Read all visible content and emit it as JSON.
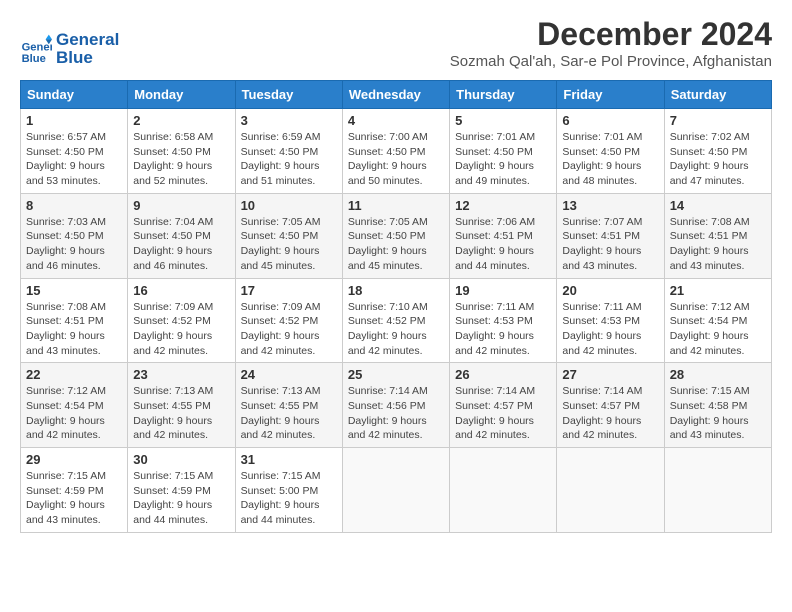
{
  "header": {
    "logo_line1": "General",
    "logo_line2": "Blue",
    "month_title": "December 2024",
    "location": "Sozmah Qal'ah, Sar-e Pol Province, Afghanistan"
  },
  "weekdays": [
    "Sunday",
    "Monday",
    "Tuesday",
    "Wednesday",
    "Thursday",
    "Friday",
    "Saturday"
  ],
  "weeks": [
    [
      {
        "day": "1",
        "sunrise": "Sunrise: 6:57 AM",
        "sunset": "Sunset: 4:50 PM",
        "daylight": "Daylight: 9 hours and 53 minutes."
      },
      {
        "day": "2",
        "sunrise": "Sunrise: 6:58 AM",
        "sunset": "Sunset: 4:50 PM",
        "daylight": "Daylight: 9 hours and 52 minutes."
      },
      {
        "day": "3",
        "sunrise": "Sunrise: 6:59 AM",
        "sunset": "Sunset: 4:50 PM",
        "daylight": "Daylight: 9 hours and 51 minutes."
      },
      {
        "day": "4",
        "sunrise": "Sunrise: 7:00 AM",
        "sunset": "Sunset: 4:50 PM",
        "daylight": "Daylight: 9 hours and 50 minutes."
      },
      {
        "day": "5",
        "sunrise": "Sunrise: 7:01 AM",
        "sunset": "Sunset: 4:50 PM",
        "daylight": "Daylight: 9 hours and 49 minutes."
      },
      {
        "day": "6",
        "sunrise": "Sunrise: 7:01 AM",
        "sunset": "Sunset: 4:50 PM",
        "daylight": "Daylight: 9 hours and 48 minutes."
      },
      {
        "day": "7",
        "sunrise": "Sunrise: 7:02 AM",
        "sunset": "Sunset: 4:50 PM",
        "daylight": "Daylight: 9 hours and 47 minutes."
      }
    ],
    [
      {
        "day": "8",
        "sunrise": "Sunrise: 7:03 AM",
        "sunset": "Sunset: 4:50 PM",
        "daylight": "Daylight: 9 hours and 46 minutes."
      },
      {
        "day": "9",
        "sunrise": "Sunrise: 7:04 AM",
        "sunset": "Sunset: 4:50 PM",
        "daylight": "Daylight: 9 hours and 46 minutes."
      },
      {
        "day": "10",
        "sunrise": "Sunrise: 7:05 AM",
        "sunset": "Sunset: 4:50 PM",
        "daylight": "Daylight: 9 hours and 45 minutes."
      },
      {
        "day": "11",
        "sunrise": "Sunrise: 7:05 AM",
        "sunset": "Sunset: 4:50 PM",
        "daylight": "Daylight: 9 hours and 45 minutes."
      },
      {
        "day": "12",
        "sunrise": "Sunrise: 7:06 AM",
        "sunset": "Sunset: 4:51 PM",
        "daylight": "Daylight: 9 hours and 44 minutes."
      },
      {
        "day": "13",
        "sunrise": "Sunrise: 7:07 AM",
        "sunset": "Sunset: 4:51 PM",
        "daylight": "Daylight: 9 hours and 43 minutes."
      },
      {
        "day": "14",
        "sunrise": "Sunrise: 7:08 AM",
        "sunset": "Sunset: 4:51 PM",
        "daylight": "Daylight: 9 hours and 43 minutes."
      }
    ],
    [
      {
        "day": "15",
        "sunrise": "Sunrise: 7:08 AM",
        "sunset": "Sunset: 4:51 PM",
        "daylight": "Daylight: 9 hours and 43 minutes."
      },
      {
        "day": "16",
        "sunrise": "Sunrise: 7:09 AM",
        "sunset": "Sunset: 4:52 PM",
        "daylight": "Daylight: 9 hours and 42 minutes."
      },
      {
        "day": "17",
        "sunrise": "Sunrise: 7:09 AM",
        "sunset": "Sunset: 4:52 PM",
        "daylight": "Daylight: 9 hours and 42 minutes."
      },
      {
        "day": "18",
        "sunrise": "Sunrise: 7:10 AM",
        "sunset": "Sunset: 4:52 PM",
        "daylight": "Daylight: 9 hours and 42 minutes."
      },
      {
        "day": "19",
        "sunrise": "Sunrise: 7:11 AM",
        "sunset": "Sunset: 4:53 PM",
        "daylight": "Daylight: 9 hours and 42 minutes."
      },
      {
        "day": "20",
        "sunrise": "Sunrise: 7:11 AM",
        "sunset": "Sunset: 4:53 PM",
        "daylight": "Daylight: 9 hours and 42 minutes."
      },
      {
        "day": "21",
        "sunrise": "Sunrise: 7:12 AM",
        "sunset": "Sunset: 4:54 PM",
        "daylight": "Daylight: 9 hours and 42 minutes."
      }
    ],
    [
      {
        "day": "22",
        "sunrise": "Sunrise: 7:12 AM",
        "sunset": "Sunset: 4:54 PM",
        "daylight": "Daylight: 9 hours and 42 minutes."
      },
      {
        "day": "23",
        "sunrise": "Sunrise: 7:13 AM",
        "sunset": "Sunset: 4:55 PM",
        "daylight": "Daylight: 9 hours and 42 minutes."
      },
      {
        "day": "24",
        "sunrise": "Sunrise: 7:13 AM",
        "sunset": "Sunset: 4:55 PM",
        "daylight": "Daylight: 9 hours and 42 minutes."
      },
      {
        "day": "25",
        "sunrise": "Sunrise: 7:14 AM",
        "sunset": "Sunset: 4:56 PM",
        "daylight": "Daylight: 9 hours and 42 minutes."
      },
      {
        "day": "26",
        "sunrise": "Sunrise: 7:14 AM",
        "sunset": "Sunset: 4:57 PM",
        "daylight": "Daylight: 9 hours and 42 minutes."
      },
      {
        "day": "27",
        "sunrise": "Sunrise: 7:14 AM",
        "sunset": "Sunset: 4:57 PM",
        "daylight": "Daylight: 9 hours and 42 minutes."
      },
      {
        "day": "28",
        "sunrise": "Sunrise: 7:15 AM",
        "sunset": "Sunset: 4:58 PM",
        "daylight": "Daylight: 9 hours and 43 minutes."
      }
    ],
    [
      {
        "day": "29",
        "sunrise": "Sunrise: 7:15 AM",
        "sunset": "Sunset: 4:59 PM",
        "daylight": "Daylight: 9 hours and 43 minutes."
      },
      {
        "day": "30",
        "sunrise": "Sunrise: 7:15 AM",
        "sunset": "Sunset: 4:59 PM",
        "daylight": "Daylight: 9 hours and 44 minutes."
      },
      {
        "day": "31",
        "sunrise": "Sunrise: 7:15 AM",
        "sunset": "Sunset: 5:00 PM",
        "daylight": "Daylight: 9 hours and 44 minutes."
      },
      null,
      null,
      null,
      null
    ]
  ]
}
